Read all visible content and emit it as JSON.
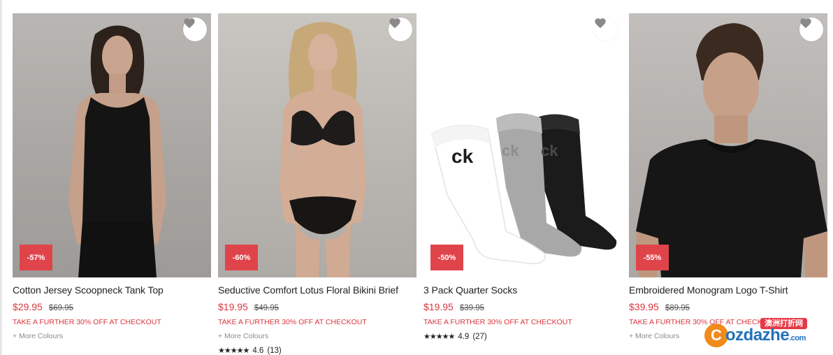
{
  "products": [
    {
      "title": "Cotton Jersey Scoopneck Tank Top",
      "price_now": "$29.95",
      "price_was": "$69.95",
      "discount": "-57%",
      "promo": "TAKE A FURTHER 30% OFF AT CHECKOUT",
      "more_colours": "+ More Colours",
      "image_subject": "woman in black tank top"
    },
    {
      "title": "Seductive Comfort Lotus Floral Bikini Brief",
      "price_now": "$19.95",
      "price_was": "$49.95",
      "discount": "-60%",
      "promo": "TAKE A FURTHER 30% OFF AT CHECKOUT",
      "more_colours": "+ More Colours",
      "rating_value": "4.6",
      "rating_count": "(13)",
      "stars": "★★★★★",
      "image_subject": "woman in black lace lingerie"
    },
    {
      "title": "3 Pack Quarter Socks",
      "price_now": "$19.95",
      "price_was": "$39.95",
      "discount": "-50%",
      "promo": "TAKE A FURTHER 30% OFF AT CHECKOUT",
      "rating_value": "4.9",
      "rating_count": "(27)",
      "stars": "★★★★★",
      "sock_logo": "ck",
      "image_subject": "white, grey and black socks"
    },
    {
      "title": "Embroidered Monogram Logo T-Shirt",
      "price_now": "$39.95",
      "price_was": "$89.95",
      "discount": "-55%",
      "promo": "TAKE A FURTHER 30% OFF AT CHECKOUT",
      "more_colours": "+ More Colours",
      "image_subject": "man in black t-shirt"
    }
  ],
  "wishlist_icon": "heart-icon",
  "colors": {
    "sale_red": "#d9363e",
    "badge_red": "#e0444b",
    "muted_text": "#8a8a8a"
  },
  "watermark": {
    "top_text": "澳洲打折网",
    "site_text": "ozdazhe",
    "tld": ".com",
    "logo_letter": "C"
  }
}
